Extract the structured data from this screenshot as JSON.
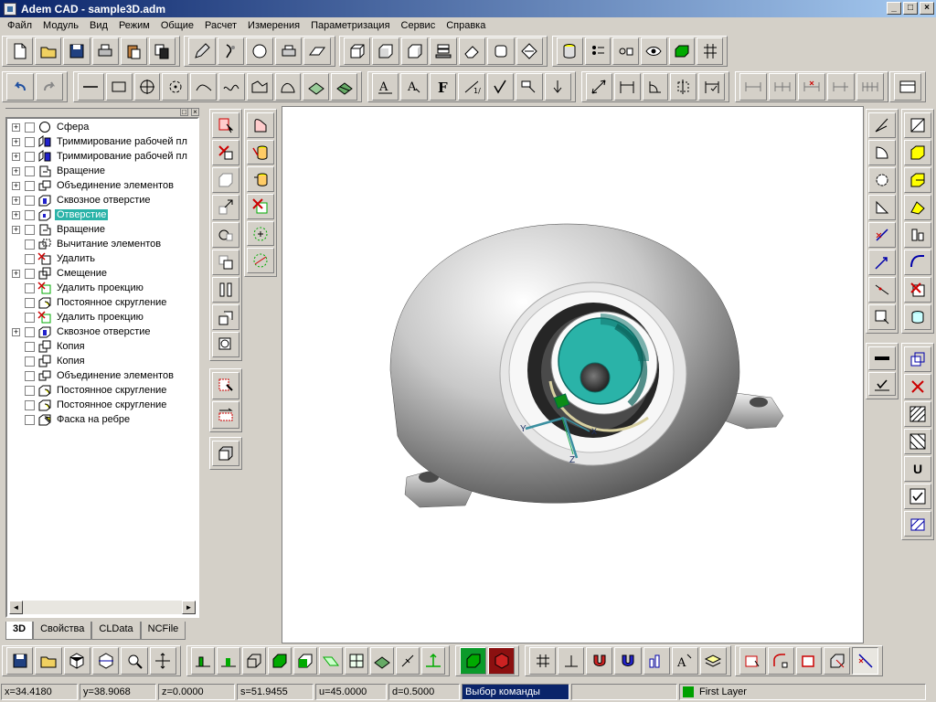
{
  "title_bar": {
    "title": "Adem CAD - sample3D.adm",
    "min": "_",
    "max": "□",
    "close": "×"
  },
  "menu": [
    "Файл",
    "Модуль",
    "Вид",
    "Режим",
    "Общие",
    "Расчет",
    "Измерения",
    "Параметризация",
    "Сервис",
    "Справка"
  ],
  "toolbar1": [
    "new-file-icon",
    "open-folder-icon",
    "save-icon",
    "print-icon",
    "paste-icon",
    "copy-icon",
    "pencil-icon",
    "brush-icon",
    "sphere-icon",
    "printer-view-icon",
    "plane-icon",
    "box-icon",
    "box-front-icon",
    "box-side-icon",
    "stack-icon",
    "eraser-icon",
    "box-round-icon",
    "box-view-icon",
    "cylinder-icon",
    "layer-list-icon",
    "view-toggle-icon",
    "eye-icon",
    "green-box-icon",
    "grid-snap-icon"
  ],
  "toolbar2": [
    "undo-icon",
    "redo-icon",
    "line-icon",
    "rect-icon",
    "circle-center-icon",
    "circle-point-icon",
    "arc-icon",
    "curve-icon",
    "polyline-icon",
    "spline-icon",
    "hatch-icon",
    "fill-icon",
    "text-icon",
    "dim-text-icon",
    "font-icon",
    "fraction-icon",
    "check-icon",
    "surface-icon",
    "arrow-down-icon",
    "diag-dim-icon",
    "horizontal-dim-icon",
    "angle-dim-icon",
    "resize-dim-icon",
    "frame-dim-icon",
    "chain-dim-1-icon",
    "chain-dim-2-icon",
    "chain-dim-3-icon",
    "chain-dim-4-icon",
    "chain-dim-5-icon",
    "panel-icon"
  ],
  "tree": {
    "items": [
      {
        "label": "Сфера",
        "expand": "+",
        "icon": "sphere-icon"
      },
      {
        "label": "Триммирование рабочей пл",
        "expand": "+",
        "icon": "trim-plane-icon"
      },
      {
        "label": "Триммирование рабочей пл",
        "expand": "+",
        "icon": "trim-plane-icon"
      },
      {
        "label": "Вращение",
        "expand": "+",
        "icon": "revolve-icon"
      },
      {
        "label": "Объединение элементов",
        "expand": "+",
        "icon": "union-icon"
      },
      {
        "label": "Сквозное отверстие",
        "expand": "+",
        "icon": "through-hole-icon"
      },
      {
        "label": "Отверстие",
        "expand": "+",
        "icon": "hole-icon",
        "selected": true
      },
      {
        "label": "Вращение",
        "expand": "+",
        "icon": "revolve-icon"
      },
      {
        "label": "Вычитание элементов",
        "expand": "",
        "icon": "subtract-icon"
      },
      {
        "label": "Удалить",
        "expand": "",
        "icon": "delete-icon"
      },
      {
        "label": "Смещение",
        "expand": "+",
        "icon": "offset-icon"
      },
      {
        "label": "Удалить проекцию",
        "expand": "",
        "icon": "delete-projection-icon"
      },
      {
        "label": "Постоянное скругление",
        "expand": "",
        "icon": "fillet-icon"
      },
      {
        "label": "Удалить проекцию",
        "expand": "",
        "icon": "delete-projection-icon"
      },
      {
        "label": "Сквозное отверстие",
        "expand": "+",
        "icon": "through-hole-icon"
      },
      {
        "label": "Копия",
        "expand": "",
        "icon": "copy-icon"
      },
      {
        "label": "Копия",
        "expand": "",
        "icon": "copy-icon"
      },
      {
        "label": "Объединение элементов",
        "expand": "",
        "icon": "union-icon"
      },
      {
        "label": "Постоянное скругление",
        "expand": "",
        "icon": "fillet-icon"
      },
      {
        "label": "Постоянное скругление",
        "expand": "",
        "icon": "fillet-icon"
      },
      {
        "label": "Фаска на ребре",
        "expand": "",
        "icon": "chamfer-icon"
      }
    ],
    "tabs": [
      "3D",
      "Свойства",
      "CLData",
      "NCFile"
    ],
    "active_tab": "3D",
    "panel_btn_a": "□",
    "panel_btn_b": "×",
    "scroll_left": "◄",
    "scroll_right": "►"
  },
  "viewport": {
    "axes": {
      "x": "X",
      "y": "Y",
      "z": "Z"
    }
  },
  "right_bar_b": {
    "u_label": "U"
  },
  "status": {
    "x": "x=34.4180",
    "y": "y=38.9068",
    "z": "z=0.0000",
    "s": "s=51.9455",
    "u": "u=45.0000",
    "d": "d=0.5000",
    "command": "Выбор команды",
    "layer": "First Layer"
  },
  "colors": {
    "accent": "#2ab3a8",
    "titlebar": "#0a246a",
    "layer": "#00a000"
  }
}
